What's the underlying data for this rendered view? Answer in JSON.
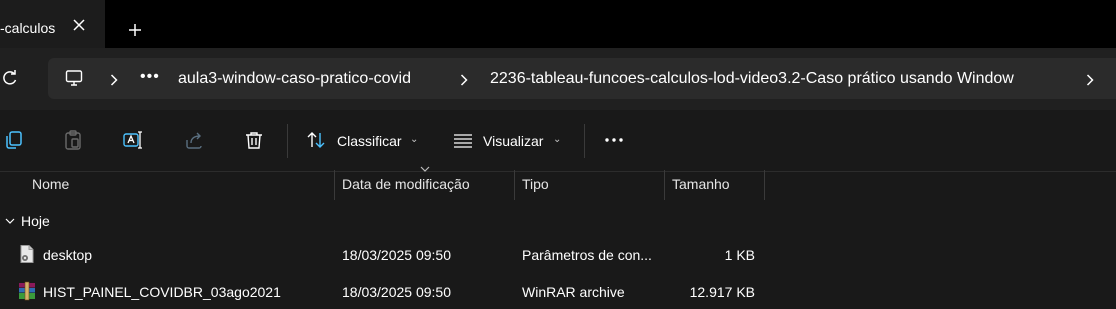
{
  "tab": {
    "title": "-calculos"
  },
  "breadcrumb": {
    "items": [
      "aula3-window-caso-pratico-covid",
      "2236-tableau-funcoes-calculos-lod-video3.2-Caso prático usando Window"
    ]
  },
  "toolbar": {
    "sort_label": "Classificar",
    "view_label": "Visualizar"
  },
  "columns": {
    "name": "Nome",
    "modified": "Data de modificação",
    "type": "Tipo",
    "size": "Tamanho"
  },
  "group": {
    "label": "Hoje"
  },
  "files": [
    {
      "name": "desktop",
      "modified": "18/03/2025 09:50",
      "type": "Parâmetros de con...",
      "size": "1 KB",
      "icon": "settings-file-icon"
    },
    {
      "name": "HIST_PAINEL_COVIDBR_03ago2021",
      "modified": "18/03/2025 09:50",
      "type": "WinRAR archive",
      "size": "12.917 KB",
      "icon": "winrar-archive-icon"
    }
  ],
  "colors": {
    "background": "#191919",
    "titlebar": "#000000",
    "address_bar": "#2b2b2b",
    "accent": "#4cc2ff"
  }
}
